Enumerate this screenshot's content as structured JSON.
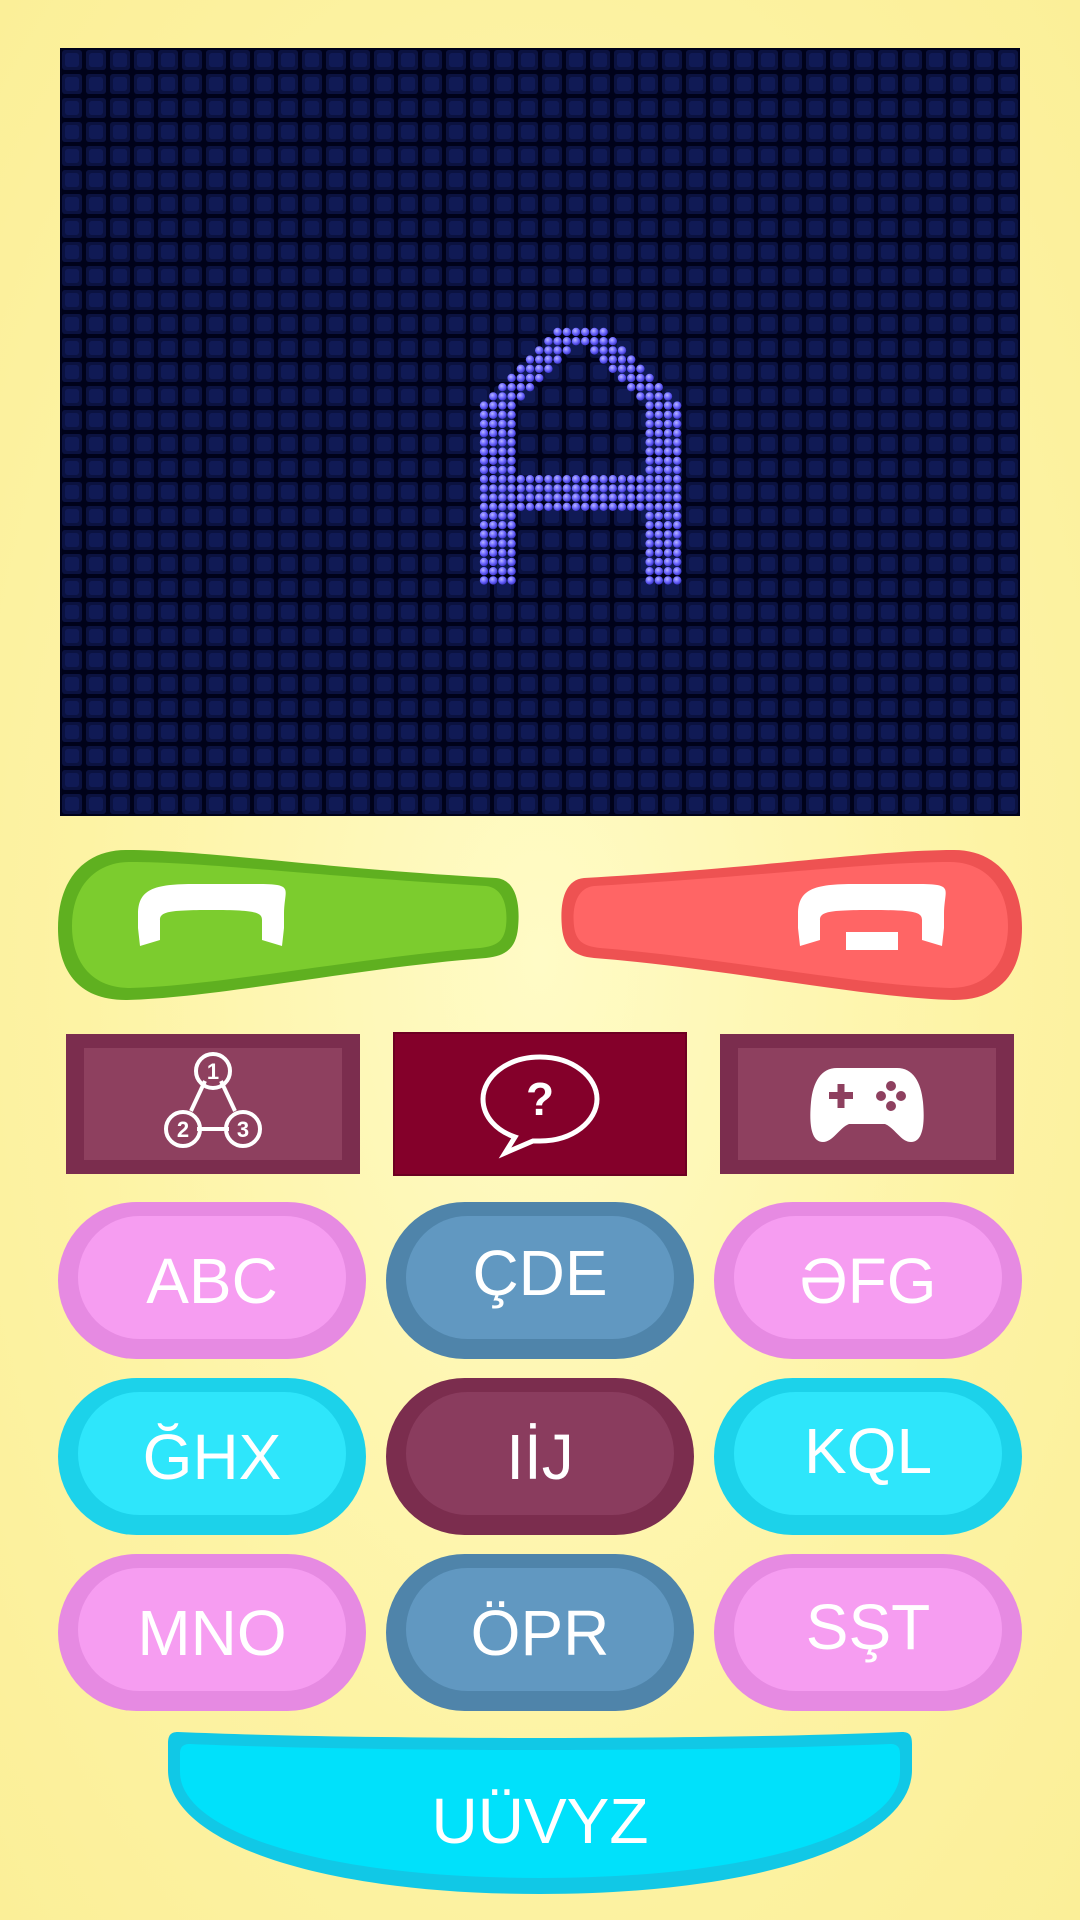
{
  "display": {
    "letter": "A",
    "led_color": "#6e69ff",
    "background_color": "#00021a"
  },
  "call_buttons": {
    "accept_color": "#7ccc2e",
    "decline_color": "#ff6565"
  },
  "mode_buttons": [
    {
      "name": "numbers",
      "icon": "numbers-icon",
      "selected": false
    },
    {
      "name": "questions",
      "icon": "question-bubble-icon",
      "selected": true
    },
    {
      "name": "games",
      "icon": "gamepad-icon",
      "selected": false
    }
  ],
  "keys": [
    {
      "label": "ABC"
    },
    {
      "label": "ÇDE"
    },
    {
      "label": "ƏFG"
    },
    {
      "label": "ĞHX"
    },
    {
      "label": "IİJ"
    },
    {
      "label": "KQL"
    },
    {
      "label": "MNO"
    },
    {
      "label": "ÖPR"
    },
    {
      "label": "SŞT"
    }
  ],
  "bottom_key": {
    "label": "UÜVYZ"
  }
}
